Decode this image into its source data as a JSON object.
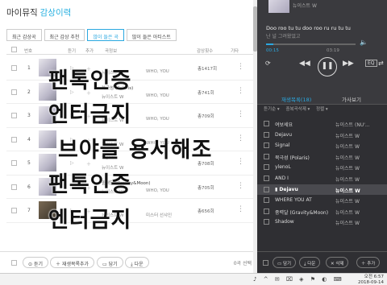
{
  "header": {
    "title": "마이뮤직",
    "subtitle": "감상이력"
  },
  "tabs": [
    {
      "label": "최근 감상곡"
    },
    {
      "label": "최근 감상 추천"
    },
    {
      "label": "많이 들은 곡",
      "active": true
    },
    {
      "label": "많이 들은 아티스트"
    }
  ],
  "columns": {
    "number": "번호",
    "listen": "듣기",
    "add": "추가",
    "title": "곡정보",
    "count": "감상횟수",
    "etc": "기타"
  },
  "rows": [
    {
      "num": "1",
      "title": "",
      "artist": "뉴이스트 W",
      "album": "WHO, YOU",
      "count": "총1417회"
    },
    {
      "num": "2",
      "title": "북극성 (Polaris)",
      "artist": "뉴이스트 W",
      "album": "WHO, YOU",
      "count": "총741회"
    },
    {
      "num": "3",
      "title": "",
      "artist": "뉴이스트 W",
      "album": "WHO, YOU",
      "count": "총709회"
    },
    {
      "num": "4",
      "title": "",
      "artist": "뉴이스트 W",
      "album": "WHO, YOU",
      "count": ""
    },
    {
      "num": "5",
      "title": "Signal",
      "artist": "뉴이스트 W",
      "album": "",
      "count": "총708회"
    },
    {
      "num": "6",
      "title": "중력달 (Gravity&Moon)",
      "artist": "뉴이스트 W",
      "album": "WHO, YOU",
      "count": "총705회"
    },
    {
      "num": "7",
      "title": "",
      "artist": "뉴이스트 W",
      "album": "미스터 선샤인",
      "count": "총656회"
    }
  ],
  "overlay": [
    "팬톡인증",
    "엔터금지",
    "브야들 용서해조",
    "팬톡인증",
    "엔터금지"
  ],
  "bottom": {
    "play": "듣기",
    "add_playlist": "재생목록추가",
    "save": "담기",
    "download": "다운",
    "selected": "0곡 선택"
  },
  "player": {
    "artist": "뉴이스트 W",
    "lyric1": "Doo roo tu tu doo roo ru ru tu tu",
    "lyric2": "난 널 그려왔었고",
    "current": "00:15",
    "total": "03:19",
    "progress": 0.08
  },
  "right_tabs": {
    "playlist": "재생목록(18)",
    "lyrics": "가사보기"
  },
  "right_tools": {
    "sort": "듣기순",
    "dedupe": "중복곡삭제",
    "arrange": "정렬"
  },
  "playlist": [
    {
      "title": "여보세요",
      "artist": "뉴이스트 (NU'..."
    },
    {
      "title": "Dejavu",
      "artist": "뉴이스트 W"
    },
    {
      "title": "Signal",
      "artist": "뉴이스트 W"
    },
    {
      "title": "북극성 (Polaris)",
      "artist": "뉴이스트 W"
    },
    {
      "title": "ylenoL",
      "artist": "뉴이스트 W"
    },
    {
      "title": "AND I",
      "artist": "뉴이스트 W"
    },
    {
      "title": "Dejavu",
      "artist": "뉴이스트 W",
      "current": true
    },
    {
      "title": "WHERE YOU AT",
      "artist": "뉴이스트 W"
    },
    {
      "title": "중력달 (Gravity&Moon)",
      "artist": "뉴이스트 W"
    },
    {
      "title": "Shadow",
      "artist": "뉴이스트 W"
    }
  ],
  "right_bottom": {
    "save": "담기",
    "download": "다운",
    "delete": "삭제",
    "add": "추가"
  },
  "taskbar": {
    "time": "오전 6:57",
    "date": "2018-09-14"
  }
}
